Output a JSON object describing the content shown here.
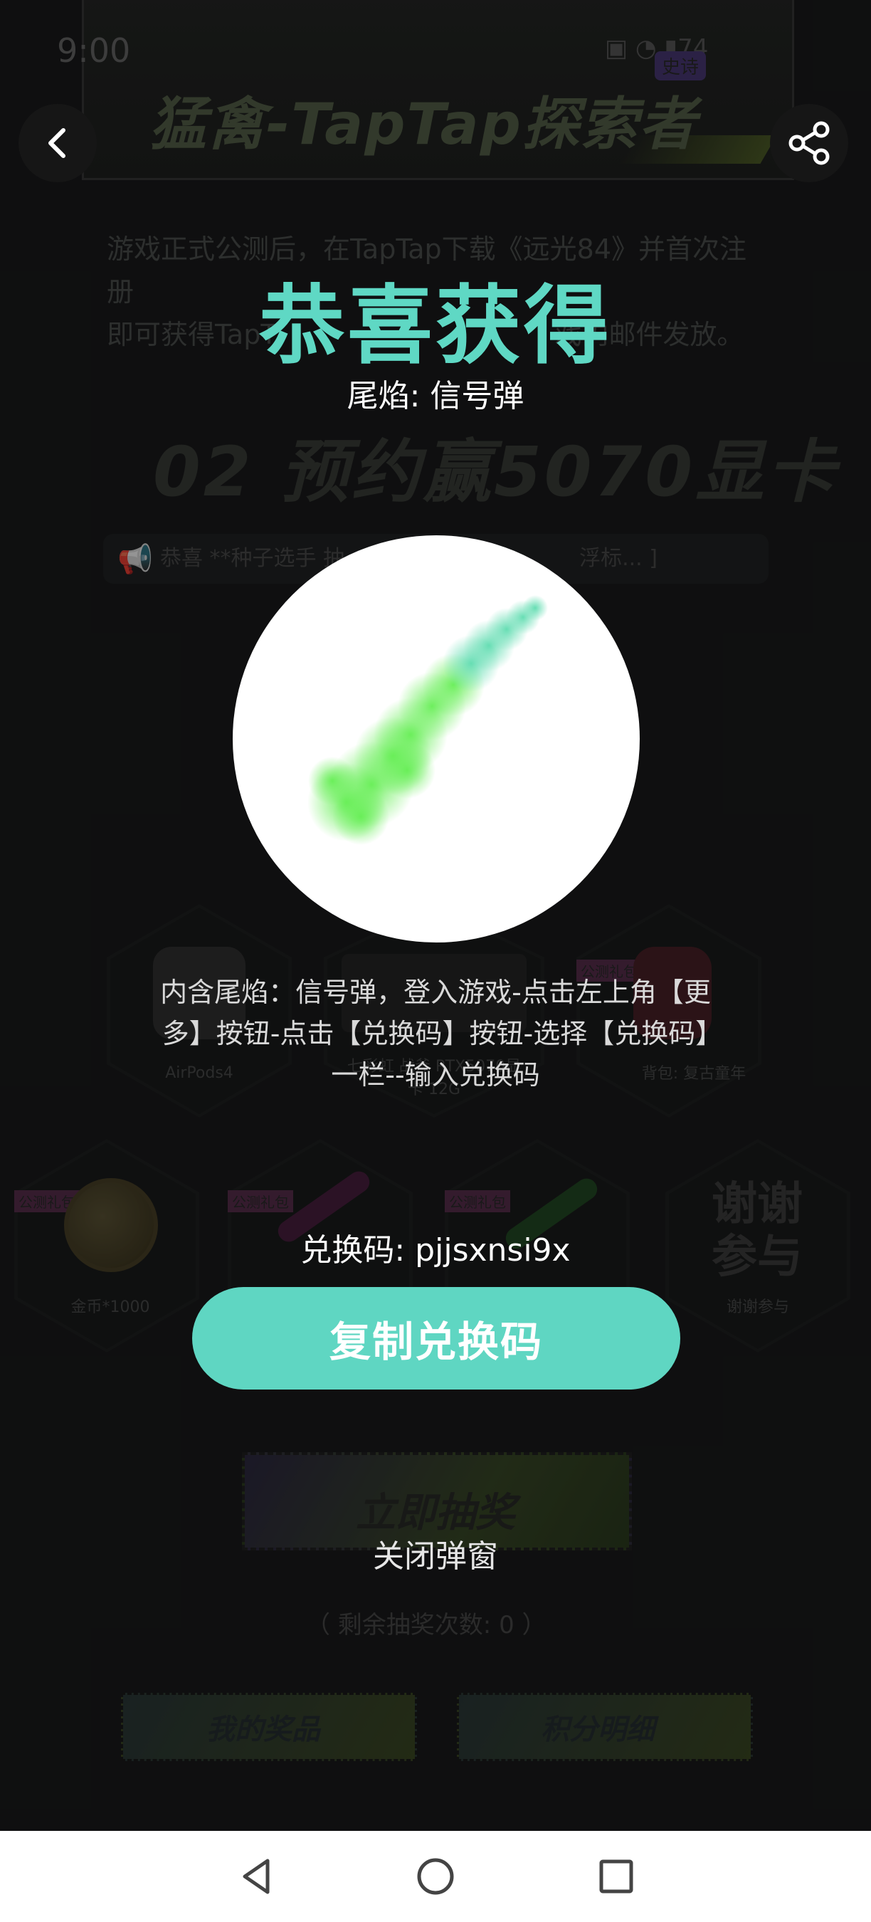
{
  "status_bar": {
    "time": "9:00",
    "battery": "74"
  },
  "background_page": {
    "brand_title": "猛禽-TapTap探索者",
    "beta_badge": "史诗",
    "description_line1": "游戏正式公测后，在TapTap下载《远光84》并首次注册",
    "description_line2": "即可获得TapT",
    "description_line2_tail": "戏内邮件发放。",
    "preorder_title": "02 预约赢5070显卡",
    "marquee_text": "恭喜 **种子选手 抽",
    "marquee_tail": "浮标... ]",
    "prizes": [
      {
        "label": "AirPods4"
      },
      {
        "label": "七彩虹 战斧 RTX5070显卡 12G"
      },
      {
        "label": "背包: 复古童年"
      },
      {
        "label": "金币*1000"
      },
      {
        "label": "谢谢参与"
      }
    ],
    "tag_public": "公测礼包",
    "thanks_big": "谢谢参与",
    "draw_button": "立即抽奖",
    "remaining_draws": "（ 剩余抽奖次数: 0 ）",
    "my_prizes_button": "我的奖品",
    "points_detail_button": "积分明细"
  },
  "modal": {
    "title": "恭喜获得",
    "subtitle": "尾焰: 信号弹",
    "reward_image": "green-flare-trail",
    "instructions": "内含尾焰：信号弹，登入游戏-点击左上角【更多】按钮-点击【兑换码】按钮-选择【兑换码】一栏--输入兑换码",
    "code_label": "兑换码: pjjsxnsi9x",
    "copy_button": "复制兑换码",
    "close_link": "关闭弹窗"
  },
  "icons": {
    "back": "back-chevron-icon",
    "share": "share-icon"
  },
  "colors": {
    "accent": "#5fd6c2",
    "title": "#5fd8c4",
    "flare_green": "#6ee85a"
  }
}
